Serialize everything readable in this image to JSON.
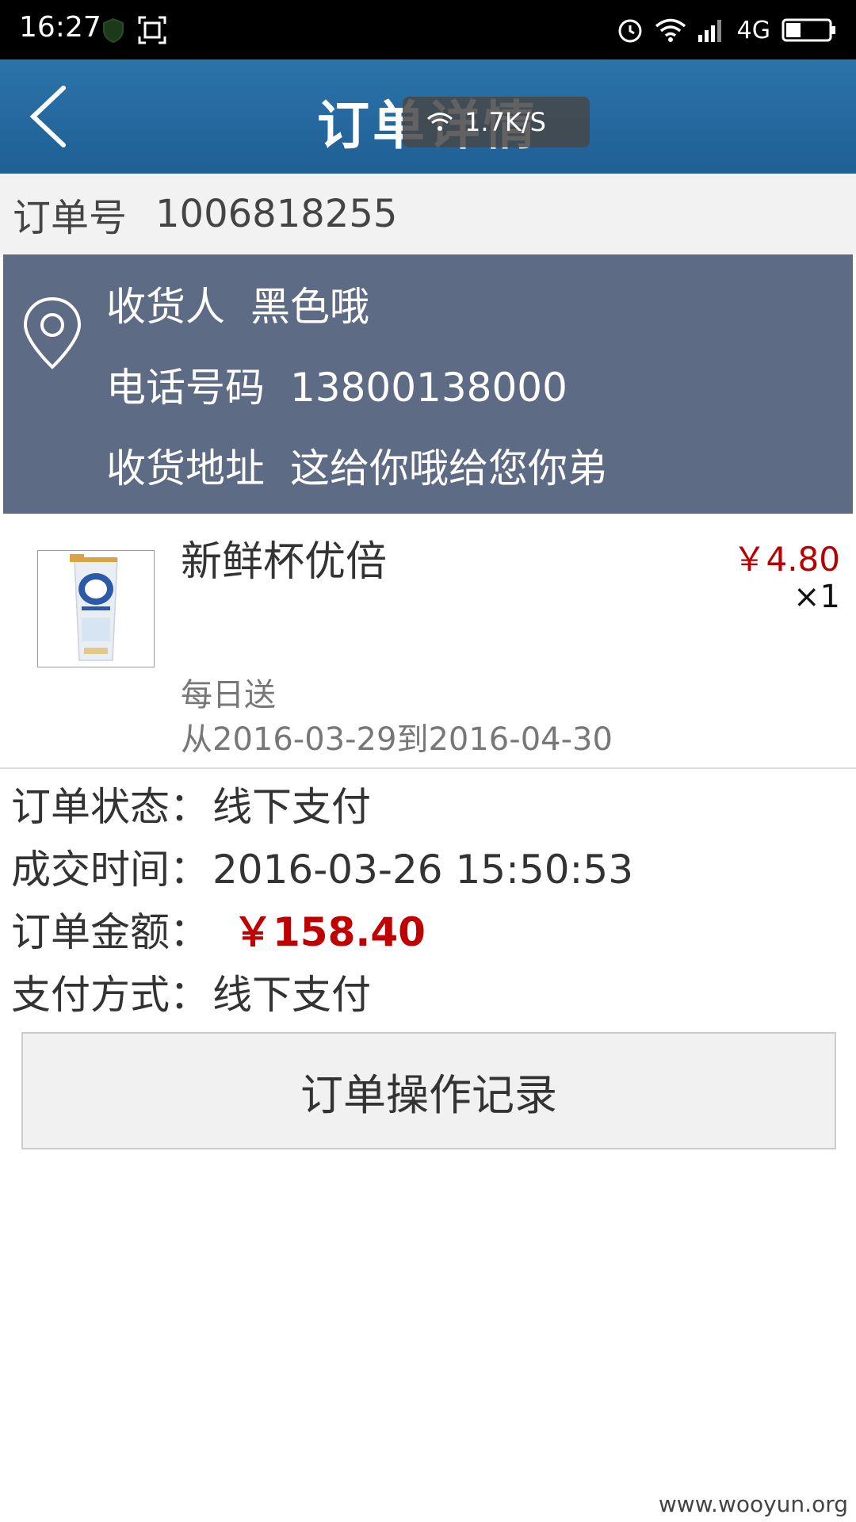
{
  "status_bar": {
    "time": "16:27",
    "network": "4G",
    "icons": [
      "shield-icon",
      "screenshot-icon",
      "alarm-icon",
      "wifi-icon",
      "signal-icon",
      "battery-icon"
    ]
  },
  "header": {
    "title": "订单详情",
    "speed_text": "1.7K/S"
  },
  "order": {
    "number_label": "订单号",
    "number": "1006818255"
  },
  "recipient": {
    "name_label": "收货人",
    "name": "黑色哦",
    "phone_label": "电话号码",
    "phone": "13800138000",
    "address_label": "收货地址",
    "address": "这给你哦给您你弟"
  },
  "product": {
    "name": "新鲜杯优倍",
    "price": "￥4.80",
    "quantity": "×1",
    "delivery": "每日送",
    "date_range": "从2016-03-29到2016-04-30"
  },
  "info": {
    "status_label": "订单状态：",
    "status": "线下支付",
    "time_label": "成交时间：",
    "time": "2016-03-26 15:50:53",
    "amount_label": "订单金额：",
    "amount": "￥158.40",
    "payment_label": "支付方式：",
    "payment": "线下支付"
  },
  "actions": {
    "log_button": "订单操作记录"
  },
  "watermark": "www.wooyun.org",
  "colors": {
    "header_blue": "#2b74ab",
    "address_bg": "#5e6b84",
    "price_red": "#c00000"
  }
}
